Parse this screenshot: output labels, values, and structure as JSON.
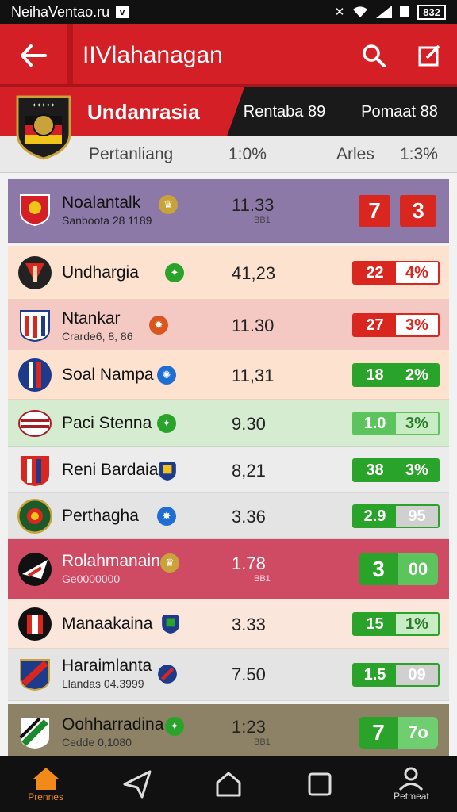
{
  "status_bar": {
    "carrier": "NeihaVentao.ru",
    "box_glyph": "v",
    "battery": "832"
  },
  "app_bar": {
    "back_icon": "arrow-left-icon",
    "title": "IIVlahanagan",
    "search_icon": "search-icon",
    "edit_icon": "edit-icon"
  },
  "team_banner": {
    "name": "Undanrasia",
    "stat_left": "Rentaba 89",
    "stat_right": "Pomaat 88"
  },
  "sub_header": {
    "label": "Pertanliang",
    "value": "1:0%",
    "col_label": "Arles",
    "col_value": "1:3%"
  },
  "rows": [
    {
      "name": "Noalantalk",
      "sub": "Sanboota 28 1189",
      "value": "11.33",
      "value_small": "BB1",
      "score_a": "7",
      "score_b": "3",
      "bg": "#8c79a8",
      "style": "squares"
    },
    {
      "name": "Undhargia",
      "sub": "",
      "value": "41,23",
      "value_small": "",
      "score_a": "22",
      "score_b": "4%",
      "bg": "#fde2d0",
      "pill_a": "#d9261f",
      "pill_b": "#ffffff",
      "pill_b_text": "#d9261f",
      "pill_border": "#d9261f"
    },
    {
      "name": "Ntankar",
      "sub": "Crarde6, 8, 86",
      "value": "11.30",
      "value_small": "",
      "score_a": "27",
      "score_b": "3%",
      "bg": "#f4c9c4",
      "pill_a": "#d9261f",
      "pill_b": "#ffffff",
      "pill_b_text": "#d9261f",
      "pill_border": "#d9261f"
    },
    {
      "name": "Soal Nampa",
      "sub": "",
      "value": "11,31",
      "value_small": "",
      "score_a": "18",
      "score_b": "2%",
      "bg": "#fde2d0",
      "pill_a": "#2aa32a",
      "pill_b": "#2aa32a",
      "pill_b_text": "#ffffff",
      "pill_border": "#2aa32a"
    },
    {
      "name": "Paci Stenna",
      "sub": "",
      "value": "9.30",
      "value_small": "",
      "score_a": "1.0",
      "score_b": "3%",
      "bg": "#d5ecd0",
      "pill_a": "#5cc45c",
      "pill_b": "#c8ecc4",
      "pill_b_text": "#2a7a2a",
      "pill_border": "#5cc45c"
    },
    {
      "name": "Reni Bardaia",
      "sub": "",
      "value": "8,21",
      "value_small": "",
      "score_a": "38",
      "score_b": "3%",
      "bg": "#ececec",
      "pill_a": "#2aa32a",
      "pill_b": "#2aa32a",
      "pill_b_text": "#ffffff",
      "pill_border": "#2aa32a"
    },
    {
      "name": "Perthagha",
      "sub": "",
      "value": "3.36",
      "value_small": "",
      "score_a": "2.9",
      "score_b": "95",
      "bg": "#e4e4e4",
      "pill_a": "#2aa32a",
      "pill_b": "#d0d0d0",
      "pill_b_text": "#ffffff",
      "pill_border": "#2aa32a"
    },
    {
      "name": "Rolahmanain",
      "sub": "Ge0000000",
      "value": "1.78",
      "value_small": "BB1",
      "score_a": "3",
      "score_b": "00",
      "bg": "#cf4a63",
      "style": "bigpill"
    },
    {
      "name": "Manaakaina",
      "sub": "",
      "value": "3.33",
      "value_small": "",
      "score_a": "15",
      "score_b": "1%",
      "bg": "#fbe6dc",
      "pill_a": "#2aa32a",
      "pill_b": "#c8ecc4",
      "pill_b_text": "#2a7a2a",
      "pill_border": "#2aa32a"
    },
    {
      "name": "Haraimlanta",
      "sub": "Llandas 04.3999",
      "value": "7.50",
      "value_small": "",
      "score_a": "1.5",
      "score_b": "09",
      "bg": "#e4e4e4",
      "pill_a": "#2aa32a",
      "pill_b": "#d0d0d0",
      "pill_b_text": "#ffffff",
      "pill_border": "#2aa32a"
    },
    {
      "name": "Oohharradina",
      "sub": "Cedde 0,1080",
      "value": "1:23",
      "value_small": "BB1",
      "score_a": "7",
      "score_b": "7o",
      "bg": "#8d8266",
      "style": "bigpill-light"
    }
  ],
  "bottom_nav": [
    {
      "label": "Prennes",
      "icon": "home-filled-icon",
      "active": true
    },
    {
      "label": "",
      "icon": "send-icon",
      "active": false
    },
    {
      "label": "",
      "icon": "home-outline-icon",
      "active": false
    },
    {
      "label": "",
      "icon": "square-icon",
      "active": false
    },
    {
      "label": "Petmeat",
      "icon": "person-icon",
      "active": false
    }
  ]
}
